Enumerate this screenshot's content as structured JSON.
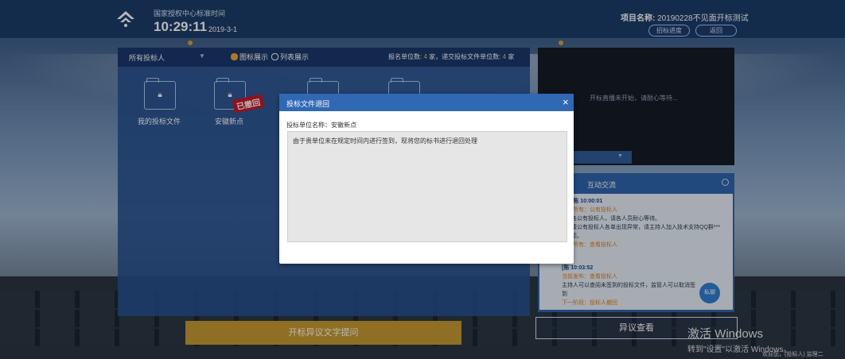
{
  "header": {
    "subtitle": "国家授权中心标准时间",
    "time": "10:29:11",
    "date": "2019-3-1",
    "project_label": "项目名称:",
    "project_name": "20190228不见面开标测试",
    "btn_progress": "招标进度",
    "btn_back": "返回"
  },
  "left_panel": {
    "selector": "所有投标人",
    "radio_icon_view": "图标展示",
    "radio_list_view": "列表展示",
    "stats_prefix": "报名单位数:",
    "signup_count": "4",
    "stats_mid": "家，递交投标文件单位数:",
    "submit_count": "4",
    "stats_suffix": "家",
    "folders": [
      {
        "label": "我的投标文件"
      },
      {
        "label": "安徽新点"
      }
    ],
    "withdrawn_stamp": "已撤回"
  },
  "video": {
    "message": "开标直播未开始，请耐心等待..."
  },
  "chat": {
    "title": "互动交流",
    "messages": [
      {
        "time": "[陈 10:00:01",
        "tag": "[所有：公有投标人",
        "line1": "各公有投标人，请各人员耐心等待。",
        "line2": "请公有投标人各单出现异常，请主持人加入技术支持QQ群***",
        "line3": "您。",
        "tag2": "[所有：查看投标人"
      },
      {
        "time": "[陈 10:03:52",
        "tag": "当前发布：查看投标人",
        "line1": "主持人可以查阅未签到的投标文件，监管人可以取消签到",
        "tag2": "下一阶段：投标人撤回"
      }
    ],
    "reply_label": "私聊"
  },
  "buttons": {
    "objection_text": "开标异议文字提问",
    "objection_view": "异议查看"
  },
  "watermark": {
    "line1": "激活 Windows",
    "line2": "转到\"设置\"以激活 Windows。",
    "line3": "欢迎您，(投标人) 监理二"
  },
  "modal": {
    "title": "投标文件退回",
    "close": "×",
    "field": "投标单位名称：安徽新点",
    "reason": "由于贵单位未在规定时间内进行签到，现将您的标书进行退回处理"
  },
  "colors": {
    "header_bg": "#1c3d6a",
    "accent_orange": "#c79a31",
    "modal_header": "#3168b3",
    "stamp_red": "#c8192b"
  }
}
